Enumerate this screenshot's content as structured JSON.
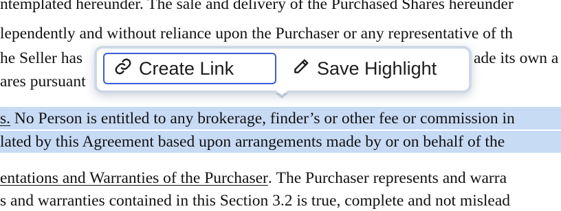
{
  "document": {
    "lines": [
      "ntemplated hereunder. The sale and delivery of the Purchased Shares hereunder",
      "lependently and without reliance upon the Purchaser or any representative of th",
      "he Seller has",
      "ade its own a",
      "ares pursuant",
      "No Person is entitled to any brokerage, finder’s or other fee or commission in",
      "lated by this Agreement based upon arrangements made by or on behalf of the",
      "The Purchaser represents and warra",
      "s and warranties contained in this Section 3.2 is true, complete and not mislead"
    ],
    "line6_lead": "s.",
    "heading_underlined": "entations and Warranties of the Purchaser",
    "heading_period": "."
  },
  "popover": {
    "create_link_label": "Create Link",
    "save_highlight_label": "Save Highlight",
    "create_link_icon": "link-icon",
    "save_highlight_icon": "pencil-icon"
  },
  "colors": {
    "highlight": "#c8dbf5",
    "focus_border": "#3b5bd6"
  }
}
